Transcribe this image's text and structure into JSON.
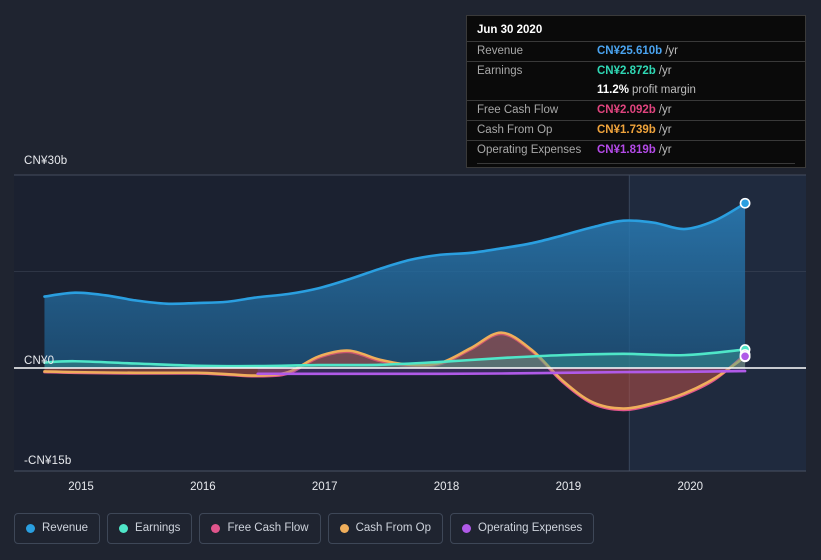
{
  "chart_data": {
    "type": "area",
    "title": "",
    "xlabel": "",
    "ylabel": "",
    "currency": "CN¥",
    "ylim": [
      -15,
      30
    ],
    "xlim": [
      2014.45,
      2020.95
    ],
    "grid": true,
    "y_ticks": [
      {
        "value": 30,
        "label": "CN¥30b"
      },
      {
        "value": 0,
        "label": "CN¥0"
      },
      {
        "value": -15,
        "label": "-CN¥15b"
      }
    ],
    "x_ticks": [
      {
        "value": 2015,
        "label": "2015"
      },
      {
        "value": 2016,
        "label": "2016"
      },
      {
        "value": 2017,
        "label": "2017"
      },
      {
        "value": 2018,
        "label": "2018"
      },
      {
        "value": 2019,
        "label": "2019"
      },
      {
        "value": 2020,
        "label": "2020"
      }
    ],
    "highlight_band": {
      "from": 2019.5,
      "to": 2020.95,
      "label": "forecast-region"
    },
    "series": [
      {
        "name": "Revenue",
        "color": "#2a9fe0",
        "fill": "rgba(35,110,170,0.55)",
        "x": [
          2014.7,
          2014.95,
          2015.2,
          2015.45,
          2015.7,
          2015.95,
          2016.2,
          2016.45,
          2016.7,
          2016.95,
          2017.2,
          2017.45,
          2017.7,
          2017.95,
          2018.2,
          2018.45,
          2018.7,
          2018.95,
          2019.2,
          2019.45,
          2019.7,
          2019.95,
          2020.2,
          2020.45
        ],
        "values": [
          11.1,
          11.7,
          11.3,
          10.5,
          10.0,
          10.1,
          10.3,
          11.0,
          11.5,
          12.4,
          13.8,
          15.4,
          16.8,
          17.6,
          17.9,
          18.6,
          19.4,
          20.6,
          21.9,
          22.9,
          22.6,
          21.6,
          22.9,
          25.6
        ]
      },
      {
        "name": "Earnings",
        "color": "#4fe6c8",
        "fill": "rgba(60,160,150,0.45)",
        "x": [
          2014.7,
          2014.95,
          2015.45,
          2015.95,
          2016.45,
          2016.95,
          2017.45,
          2017.95,
          2018.45,
          2018.95,
          2019.45,
          2019.95,
          2020.45
        ],
        "values": [
          0.85,
          1.05,
          0.7,
          0.35,
          0.3,
          0.45,
          0.5,
          0.95,
          1.55,
          2.0,
          2.2,
          2.0,
          2.87
        ]
      },
      {
        "name": "Free Cash Flow",
        "color": "#e0558c",
        "fill": "rgba(170,60,80,0.40)",
        "x": [
          2014.7,
          2014.95,
          2015.45,
          2015.95,
          2016.2,
          2016.45,
          2016.7,
          2016.95,
          2017.2,
          2017.45,
          2017.7,
          2017.95,
          2018.2,
          2018.45,
          2018.7,
          2018.95,
          2019.2,
          2019.45,
          2019.7,
          2019.95,
          2020.2,
          2020.45
        ],
        "values": [
          -0.6,
          -0.7,
          -0.8,
          -0.8,
          -1.0,
          -1.2,
          -0.8,
          1.6,
          2.5,
          1.1,
          0.3,
          0.6,
          2.9,
          5.3,
          2.6,
          -2.0,
          -5.2,
          -6.1,
          -5.3,
          -3.9,
          -1.7,
          2.09
        ]
      },
      {
        "name": "Cash From Op",
        "color": "#efae5b",
        "fill": "rgba(170,90,60,0.35)",
        "x": [
          2014.7,
          2014.95,
          2015.45,
          2015.95,
          2016.2,
          2016.45,
          2016.7,
          2016.95,
          2017.2,
          2017.45,
          2017.7,
          2017.95,
          2018.2,
          2018.45,
          2018.7,
          2018.95,
          2019.2,
          2019.45,
          2019.7,
          2019.95,
          2020.2,
          2020.45
        ],
        "values": [
          -0.5,
          -0.6,
          -0.7,
          -0.7,
          -0.9,
          -1.1,
          -0.6,
          1.8,
          2.7,
          1.3,
          0.5,
          0.8,
          3.1,
          5.5,
          2.8,
          -1.8,
          -5.0,
          -5.9,
          -5.1,
          -3.7,
          -1.5,
          1.74
        ]
      },
      {
        "name": "Operating Expenses",
        "color": "#b05ae8",
        "fill": "rgba(120,70,180,0.30)",
        "x": [
          2016.45,
          2016.95,
          2017.45,
          2017.95,
          2018.45,
          2018.95,
          2019.45,
          2019.95,
          2020.45
        ],
        "values": [
          -0.85,
          -0.85,
          -0.85,
          -0.85,
          -0.8,
          -0.7,
          -0.6,
          -0.55,
          -0.45
        ]
      }
    ],
    "endpoint_markers": [
      {
        "series": "Revenue",
        "x": 2020.45,
        "value": 25.61,
        "color": "#2a9fe0"
      },
      {
        "series": "Earnings",
        "x": 2020.45,
        "value": 2.872,
        "color": "#4fe6c8"
      },
      {
        "series": "Free Cash Flow",
        "x": 2020.45,
        "value": 2.092,
        "color": "#e0558c"
      },
      {
        "series": "Cash From Op",
        "x": 2020.45,
        "value": 1.739,
        "color": "#efae5b"
      },
      {
        "series": "Operating Expenses",
        "x": 2020.45,
        "value": 1.819,
        "color": "#b05ae8"
      }
    ]
  },
  "tooltip": {
    "date": "Jun 30 2020",
    "unit_suffix": "/yr",
    "rows": [
      {
        "label": "Revenue",
        "value": "CN¥25.610b",
        "color": "#4aa3ef",
        "unit": "/yr"
      },
      {
        "label": "Earnings",
        "value": "CN¥2.872b",
        "color": "#2fd8b4",
        "unit": "/yr"
      },
      {
        "label": "Free Cash Flow",
        "value": "CN¥2.092b",
        "color": "#e0447e",
        "unit": "/yr"
      },
      {
        "label": "Cash From Op",
        "value": "CN¥1.739b",
        "color": "#efa33b",
        "unit": "/yr"
      },
      {
        "label": "Operating Expenses",
        "value": "CN¥1.819b",
        "color": "#b44ae8",
        "unit": "/yr"
      }
    ],
    "sub_row": {
      "value": "11.2%",
      "label": "profit margin"
    }
  },
  "legend": {
    "items": [
      {
        "label": "Revenue",
        "color": "#2a9fe0"
      },
      {
        "label": "Earnings",
        "color": "#4fe6c8"
      },
      {
        "label": "Free Cash Flow",
        "color": "#e0558c"
      },
      {
        "label": "Cash From Op",
        "color": "#efae5b"
      },
      {
        "label": "Operating Expenses",
        "color": "#b05ae8"
      }
    ]
  }
}
